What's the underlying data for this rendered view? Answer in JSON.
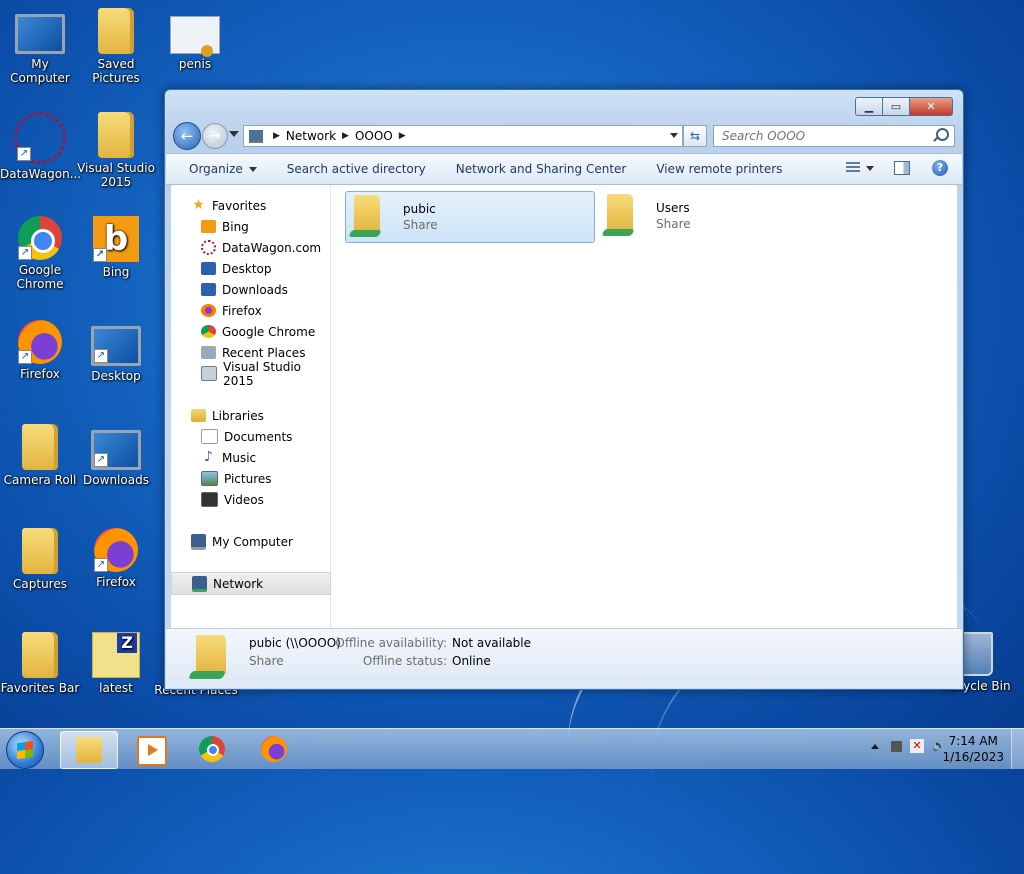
{
  "desktop": {
    "icons": [
      {
        "label": "My Computer"
      },
      {
        "label": "Saved Pictures"
      },
      {
        "label": "penis"
      },
      {
        "label": "DataWagon..."
      },
      {
        "label": "Visual Studio 2015"
      },
      {
        "label": "Google Chrome"
      },
      {
        "label": "Bing"
      },
      {
        "label": "Firefox"
      },
      {
        "label": "Desktop"
      },
      {
        "label": "Camera Roll"
      },
      {
        "label": "Downloads"
      },
      {
        "label": "Captures"
      },
      {
        "label": "Firefox"
      },
      {
        "label": "Favorites Bar"
      },
      {
        "label": "latest"
      },
      {
        "label": "Recent Places"
      },
      {
        "label": "Recycle Bin"
      }
    ]
  },
  "window": {
    "address": {
      "crumbs": [
        "Network",
        "OOOO"
      ]
    },
    "search": {
      "placeholder": "Search OOOO"
    },
    "toolbar": {
      "organize": "Organize",
      "search_ad": "Search active directory",
      "network_sharing": "Network and Sharing Center",
      "view_printers": "View remote printers"
    },
    "nav": {
      "favorites": {
        "label": "Favorites",
        "items": [
          "Bing",
          "DataWagon.com",
          "Desktop",
          "Downloads",
          "Firefox",
          "Google Chrome",
          "Recent Places",
          "Visual Studio 2015"
        ]
      },
      "libraries": {
        "label": "Libraries",
        "items": [
          "Documents",
          "Music",
          "Pictures",
          "Videos"
        ]
      },
      "my_computer": "My Computer",
      "network": "Network"
    },
    "items": [
      {
        "name": "pubic",
        "type": "Share",
        "selected": true
      },
      {
        "name": "Users",
        "type": "Share",
        "selected": false
      }
    ],
    "details": {
      "name": "pubic (\\\\OOOO)",
      "type": "Share",
      "offline_availability_label": "Offline availability:",
      "offline_availability_value": "Not available",
      "offline_status_label": "Offline status:",
      "offline_status_value": "Online"
    }
  },
  "taskbar": {
    "time": "7:14 AM",
    "date": "1/16/2023"
  },
  "icons": {
    "start": "windows-orb-icon",
    "explorer": "folder-icon",
    "media": "media-player-icon",
    "chrome": "chrome-icon",
    "firefox": "firefox-icon"
  },
  "colors": {
    "desktop_blue": "#1464c0",
    "selection": "#cce4f7",
    "link_text": "#1e395b"
  }
}
